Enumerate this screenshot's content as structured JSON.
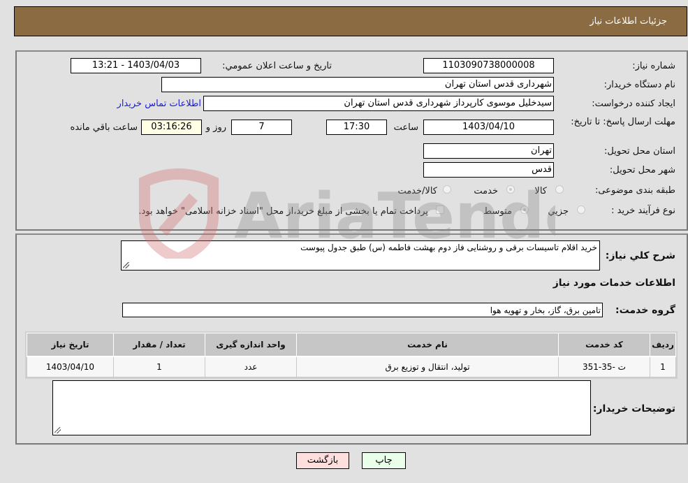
{
  "header": {
    "title": "جزئيات اطلاعات نياز"
  },
  "form": {
    "need_number": {
      "label": "شماره نياز:",
      "value": "1103090738000008"
    },
    "announce_datetime": {
      "label": "تاريخ و ساعت اعلان عمومي:",
      "value": "1403/04/03 - 13:21"
    },
    "buyer_org": {
      "label": "نام دستگاه خريدار:",
      "value": "شهرداری قدس استان تهران"
    },
    "requester": {
      "label": "ايجاد کننده درخواست:",
      "value": "سيدخليل موسوی کارپرداز شهرداری قدس استان تهران",
      "contact_link": "اطلاعات تماس خريدار"
    },
    "deadline": {
      "label": "مهلت ارسال پاسخ: تا تاريخ:",
      "date": "1403/04/10",
      "time_label": "ساعت",
      "time": "17:30",
      "days": "7",
      "days_label": "روز و",
      "remaining": "03:16:26",
      "remaining_label": "ساعت باقي مانده"
    },
    "delivery_province": {
      "label": "استان محل تحويل:",
      "value": "تهران"
    },
    "delivery_city": {
      "label": "شهر محل تحويل:",
      "value": "قدس"
    },
    "category": {
      "label": "طبقه بندی موضوعی:",
      "options": [
        "کالا",
        "خدمت",
        "کالا/خدمت"
      ],
      "selected": "خدمت"
    },
    "purchase_type": {
      "label": "نوع فرآيند خريد :",
      "options": [
        "جزيي",
        "متوسط"
      ],
      "selected": "متوسط",
      "treasury_note": "پرداخت تمام يا بخشی از مبلغ خريد،از محل \"اسناد خزانه اسلامی\" خواهد بود."
    }
  },
  "details": {
    "general_desc_label": "شرح کلي نياز:",
    "general_desc_value": "خريد اقلام تاسيسات برقی و روشنايی فاز دوم بهشت فاطمه (س)  طبق جدول پيوست",
    "services_heading": "اطلاعات خدمات مورد نياز",
    "service_group_label": "گروه خدمت:",
    "service_group_value": "تامين برق، گاز، بخار و تهويه هوا",
    "table": {
      "headers": [
        "رديف",
        "کد خدمت",
        "نام خدمت",
        "واحد اندازه گيری",
        "تعداد / مقدار",
        "تاريخ نياز"
      ],
      "rows": [
        [
          "1",
          "ت -35-351",
          "توليد، انتقال و توزيع برق",
          "عدد",
          "1",
          "1403/04/10"
        ]
      ]
    },
    "buyer_notes_label": "توضيحات خريدار:",
    "buyer_notes_value": ""
  },
  "buttons": {
    "print": "چاپ",
    "back": "بازگشت"
  },
  "colors": {
    "header_bg": "#8b6c42",
    "print_bg": "#eaffea",
    "back_bg": "#ffdede",
    "link": "#1a1ad6"
  }
}
